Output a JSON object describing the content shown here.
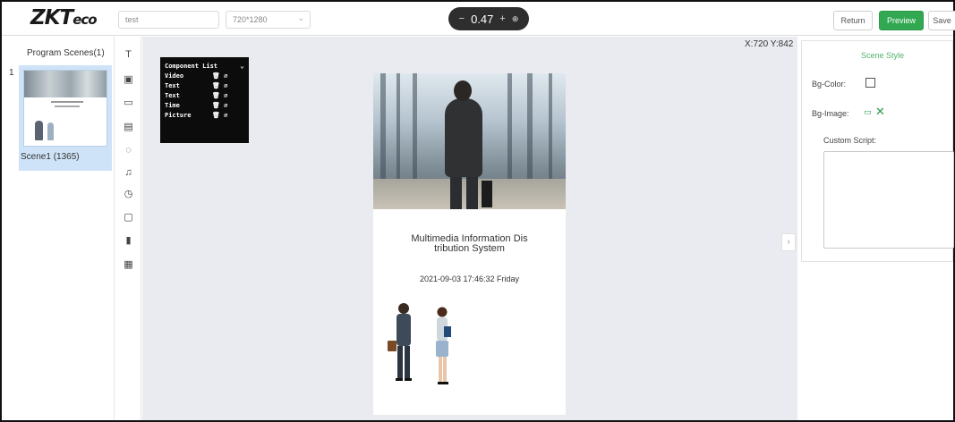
{
  "app": {
    "logo_main": "ZKT",
    "logo_accent": "eco"
  },
  "toolbar": {
    "program_name": "test",
    "resolution": "720*1280",
    "zoom_minus": "−",
    "zoom_value": "0.47",
    "zoom_plus": "+",
    "return_label": "Return",
    "preview_label": "Preview",
    "save_label": "Save"
  },
  "scenes": {
    "title": "Program Scenes(1)",
    "items": [
      {
        "index": "1",
        "label": "Scene1   (1365)"
      }
    ]
  },
  "tools": [
    {
      "glyph": "T",
      "icon": "text-tool-icon"
    },
    {
      "glyph": "▣",
      "icon": "image-tool-icon"
    },
    {
      "glyph": "▭",
      "icon": "video-tool-icon"
    },
    {
      "glyph": "▤",
      "icon": "slideshow-tool-icon"
    },
    {
      "glyph": "◌",
      "icon": "web-tool-icon"
    },
    {
      "glyph": "♫",
      "icon": "audio-tool-icon"
    },
    {
      "glyph": "◷",
      "icon": "clock-tool-icon"
    },
    {
      "glyph": "▢",
      "icon": "window-tool-icon"
    },
    {
      "glyph": "▮",
      "icon": "device-tool-icon"
    },
    {
      "glyph": "▦",
      "icon": "table-tool-icon"
    }
  ],
  "canvas": {
    "coords": "X:720 Y:842",
    "collapse_glyph": "›",
    "component_list": {
      "title": "Component List",
      "items": [
        "Video",
        "Text",
        "Text",
        "Time",
        "Picture"
      ]
    },
    "screen": {
      "title_line1": "Multimedia Information Dis",
      "title_line2": "tribution System",
      "datetime": "2021-09-03 17:46:32 Friday"
    }
  },
  "properties": {
    "title": "Scene Style",
    "bg_color_label": "Bg-Color:",
    "bg_image_label": "Bg-Image:",
    "custom_script_label": "Custom Script:",
    "custom_script_value": ""
  }
}
